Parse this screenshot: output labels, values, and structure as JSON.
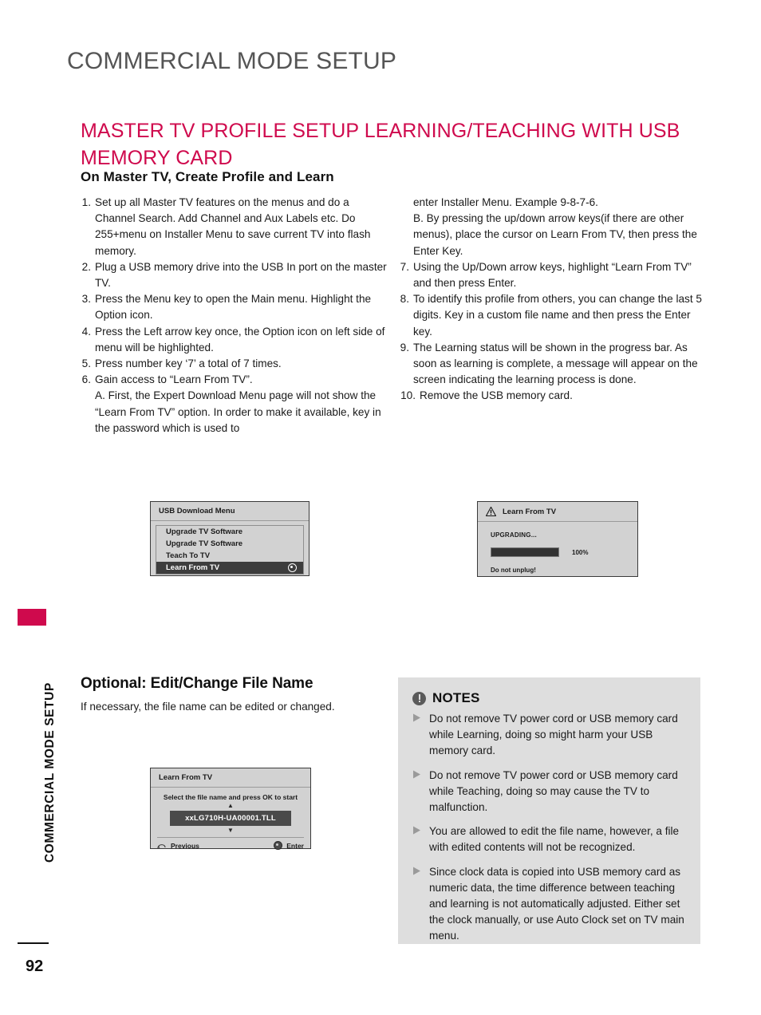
{
  "header": {
    "title": "COMMERCIAL MODE SETUP"
  },
  "section": {
    "heading": "MASTER TV PROFILE SETUP LEARNING/TEACHING WITH USB MEMORY CARD",
    "subheading": "On Master TV, Create Profile and Learn",
    "accent_color": "#cf0a4d"
  },
  "steps_left": [
    {
      "num": "1.",
      "text": "Set up all Master TV features on the menus and do a Channel Search. Add Channel and Aux Labels etc. Do 255+menu on Installer Menu to save current TV into flash memory."
    },
    {
      "num": "2.",
      "text": "Plug a USB memory drive into the USB In port on the master TV."
    },
    {
      "num": "3.",
      "text": "Press the Menu key to open the Main menu. Highlight the Option icon."
    },
    {
      "num": "4.",
      "text": "Press the Left arrow key once, the Option icon on left side of menu will be highlighted."
    },
    {
      "num": "5.",
      "text": "Press number key ‘7’ a total of 7 times."
    },
    {
      "num": "6.",
      "text": "Gain access to “Learn From TV”."
    }
  ],
  "substep_left": "A. First, the Expert Download Menu page will not show the “Learn From TV” option. In order to make it available, key in the password which is used to",
  "right_continuation": "enter Installer Menu. Example 9-8-7-6.",
  "substep_right": "B. By pressing the up/down arrow keys(if there are other menus), place the cursor on Learn From TV, then press the Enter Key.",
  "steps_right": [
    {
      "num": "7.",
      "text": "Using the Up/Down arrow keys, highlight “Learn From TV” and then press Enter."
    },
    {
      "num": "8.",
      "text": "To identify this profile from others, you can change the last 5 digits.  Key in a custom file name and then press the Enter key."
    },
    {
      "num": "9.",
      "text": "The Learning status will be shown in the progress bar. As soon as learning is complete, a message will appear on the screen indicating the learning process is done."
    },
    {
      "num": "10.",
      "text": "Remove the USB memory card."
    }
  ],
  "usb_menu": {
    "title": "USB Download Menu",
    "items": [
      {
        "label": "Upgrade TV Software",
        "selected": false
      },
      {
        "label": "Upgrade TV Software",
        "selected": false
      },
      {
        "label": "Teach To TV",
        "selected": false
      },
      {
        "label": "Learn From TV",
        "selected": true
      }
    ]
  },
  "learn_progress": {
    "title": "Learn From TV",
    "status": "UPGRADING...",
    "percent_label": "100%",
    "percent_value": 100,
    "warning": "Do not unplug!"
  },
  "filename_dialog": {
    "title": "Learn From TV",
    "instruction": "Select the  file name and press OK to start",
    "up_caret": "▲",
    "down_caret": "▼",
    "filename": "xxLG710H-UA00001.TLL",
    "previous_label": "Previous",
    "enter_label": "Enter"
  },
  "optional": {
    "heading": "Optional: Edit/Change File Name",
    "text": "If necessary, the file name can be edited or changed."
  },
  "notes": {
    "title": "NOTES",
    "bullet_glyph": "▶",
    "items": [
      "Do not remove TV power cord or USB memory card while Learning, doing so might harm your USB memory card.",
      "Do not remove TV power cord or USB memory card while Teaching, doing so may cause the TV to malfunction.",
      "You are allowed to edit the file name, however, a file with edited contents will not be recognized.",
      "Since clock data is copied into USB memory card as numeric data, the time difference between teaching and learning is not automatically adjusted. Either set the clock manually, or use Auto Clock set on TV main menu."
    ]
  },
  "side_tab": {
    "label": "COMMERCIAL MODE SETUP"
  },
  "footer": {
    "page_number": "92"
  }
}
